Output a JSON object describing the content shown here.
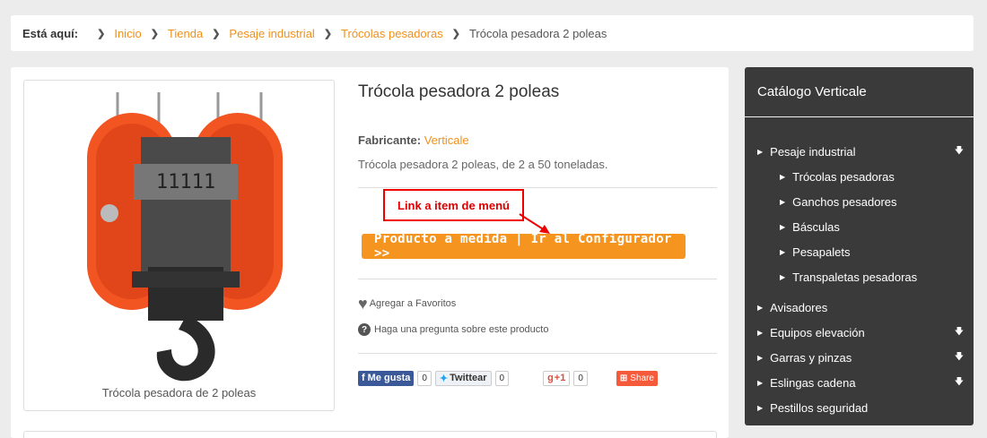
{
  "breadcrumb": {
    "label": "Está aquí:",
    "items": [
      "Inicio",
      "Tienda",
      "Pesaje industrial",
      "Trócolas pesadoras"
    ],
    "current": "Trócola pesadora 2 poleas"
  },
  "product": {
    "title": "Trócola pesadora 2 poleas",
    "image_caption": "Trócola pesadora de 2 poleas",
    "maker_label": "Fabricante:",
    "maker_name": "Verticale",
    "description": "Trócola pesadora 2 poleas, de 2 a 50 toneladas.",
    "annotation": "Link a item de menú",
    "cta_label": "Producto a medida | Ir al Configurador >>",
    "favorites_label": "Agregar a Favoritos",
    "ask_label": "Haga una pregunta sobre este producto"
  },
  "social": {
    "facebook_label": "Me gusta",
    "facebook_count": "0",
    "twitter_label": "Twittear",
    "twitter_count": "0",
    "gplus_label": "+1",
    "gplus_count": "0",
    "share_label": "Share"
  },
  "sidebar": {
    "title": "Catálogo Verticale",
    "items": [
      {
        "label": "Pesaje industrial"
      },
      {
        "label": "Trócolas pesadoras"
      },
      {
        "label": "Ganchos pesadores"
      },
      {
        "label": "Básculas"
      },
      {
        "label": "Pesapalets"
      },
      {
        "label": "Transpaletas pesadoras"
      },
      {
        "label": "Avisadores"
      },
      {
        "label": "Equipos elevación"
      },
      {
        "label": "Garras y pinzas"
      },
      {
        "label": "Eslingas cadena"
      },
      {
        "label": "Pestillos seguridad"
      }
    ]
  },
  "colors": {
    "accent": "#f5941f",
    "link": "#f0901b",
    "sidebar_bg": "#3a3a3a",
    "annotation": "#e00000"
  }
}
